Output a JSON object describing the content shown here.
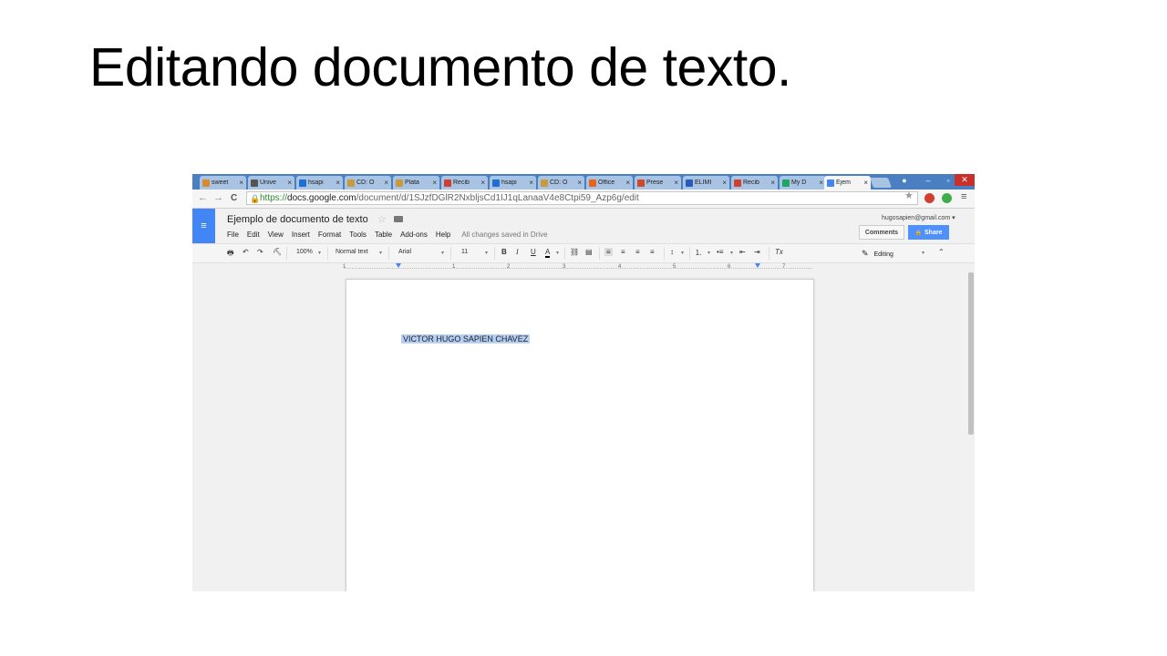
{
  "slide": {
    "title": "Editando documento de texto."
  },
  "browser": {
    "tabs": [
      {
        "label": "sweet",
        "favicon_color": "#d98a2b"
      },
      {
        "label": "Unive",
        "favicon_color": "#555555"
      },
      {
        "label": "hsapi",
        "favicon_color": "#1f6fd0"
      },
      {
        "label": "CD: O",
        "favicon_color": "#c89a3a"
      },
      {
        "label": "Plata",
        "favicon_color": "#c89a3a"
      },
      {
        "label": "Recib",
        "favicon_color": "#d23f31"
      },
      {
        "label": "hsapi",
        "favicon_color": "#1f6fd0"
      },
      {
        "label": "CD: O",
        "favicon_color": "#c89a3a"
      },
      {
        "label": "Office",
        "favicon_color": "#e8641b"
      },
      {
        "label": "Prese",
        "favicon_color": "#d24726"
      },
      {
        "label": "ELIMI",
        "favicon_color": "#2a5bb8"
      },
      {
        "label": "Recib",
        "favicon_color": "#d23f31"
      },
      {
        "label": "My D",
        "favicon_color": "#1fa463"
      },
      {
        "label": "Ejem",
        "favicon_color": "#4285f4"
      }
    ],
    "tab_close": "×",
    "url_protocol": "https://",
    "url_host": "docs.google.com",
    "url_path": "/document/d/1SJzfDGlR2NxbljsCd1IJ1qLanaaV4e8Ctpi59_Azp6g/edit",
    "back": "←",
    "forward": "→",
    "reload": "C",
    "lock": "🔒",
    "star": "★",
    "menu": "≡"
  },
  "docs": {
    "logo": "≡",
    "title": "Ejemplo de documento de texto",
    "title_star": "☆",
    "menus": [
      "File",
      "Edit",
      "View",
      "Insert",
      "Format",
      "Tools",
      "Table",
      "Add-ons",
      "Help"
    ],
    "saved_status": "All changes saved in Drive",
    "account": "hugosapien@gmail.com",
    "account_caret": "▾",
    "comments_label": "Comments",
    "share_label": "Share",
    "share_icon": "🔒",
    "toolbar": {
      "print": "🖶",
      "undo": "↶",
      "redo": "↷",
      "paint": "⛏",
      "zoom": "100%",
      "style": "Normal text",
      "font": "Arial",
      "size": "11",
      "bold": "B",
      "italic": "I",
      "underline": "U",
      "text_color": "A",
      "link": "⛓",
      "comment": "▤",
      "align_left": "≡",
      "align_center": "≡",
      "align_right": "≡",
      "align_justify": "≡",
      "line_spacing": "↕",
      "numbered_list": "⒈",
      "bulleted_list": "•≡",
      "decrease_indent": "⇤",
      "increase_indent": "⇥",
      "clear_format": "Tx",
      "caret": "▾",
      "editing_icon": "✎",
      "editing_label": "Editing",
      "collapse": "⌃"
    },
    "ruler_numbers": [
      "1",
      "1",
      "2",
      "3",
      "4",
      "5",
      "6",
      "7"
    ],
    "body_text": "VICTOR HUGO SAPIEN CHAVEZ"
  }
}
